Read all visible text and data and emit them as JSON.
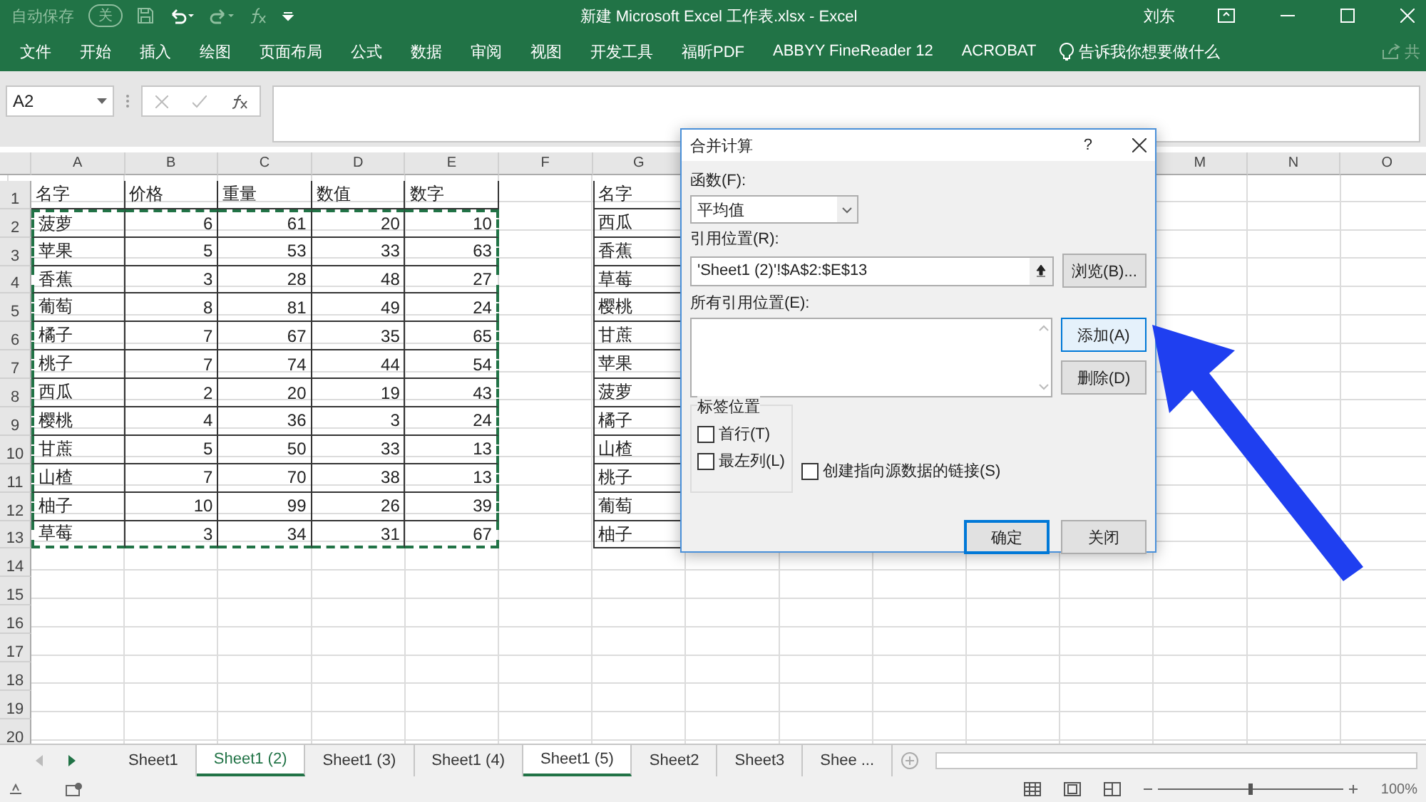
{
  "title_bar": {
    "autosave_label": "自动保存",
    "autosave_toggle": "关",
    "autosave_on": false,
    "title": "新建 Microsoft Excel 工作表.xlsx  -  Excel",
    "user": "刘东"
  },
  "ribbon_tabs": [
    {
      "label": "文件"
    },
    {
      "label": "开始"
    },
    {
      "label": "插入"
    },
    {
      "label": "绘图"
    },
    {
      "label": "页面布局"
    },
    {
      "label": "公式"
    },
    {
      "label": "数据"
    },
    {
      "label": "审阅"
    },
    {
      "label": "视图"
    },
    {
      "label": "开发工具"
    },
    {
      "label": "福昕PDF"
    },
    {
      "label": "ABBYY FineReader 12"
    },
    {
      "label": "ACROBAT"
    }
  ],
  "tell_me": "告诉我你想要做什么",
  "share_label": "共",
  "formula_bar": {
    "name_box": "A2"
  },
  "column_headers": [
    "A",
    "B",
    "C",
    "D",
    "E",
    "F",
    "G",
    "M",
    "N",
    "O"
  ],
  "row_numbers": [
    "1",
    "2",
    "3",
    "4",
    "5",
    "6",
    "7",
    "8",
    "9",
    "10",
    "11",
    "12",
    "13",
    "14",
    "15",
    "16",
    "17",
    "18",
    "19",
    "20"
  ],
  "table": {
    "marquee": true,
    "header": [
      "名字",
      "价格",
      "重量",
      "数值",
      "数字"
    ],
    "rows": [
      [
        "菠萝",
        "6",
        "61",
        "20",
        "10"
      ],
      [
        "苹果",
        "5",
        "53",
        "33",
        "63"
      ],
      [
        "香蕉",
        "3",
        "28",
        "48",
        "27"
      ],
      [
        "葡萄",
        "8",
        "81",
        "49",
        "24"
      ],
      [
        "橘子",
        "7",
        "67",
        "35",
        "65"
      ],
      [
        "桃子",
        "7",
        "74",
        "44",
        "54"
      ],
      [
        "西瓜",
        "2",
        "20",
        "19",
        "43"
      ],
      [
        "樱桃",
        "4",
        "36",
        "3",
        "24"
      ],
      [
        "甘蔗",
        "5",
        "50",
        "33",
        "13"
      ],
      [
        "山楂",
        "7",
        "70",
        "38",
        "13"
      ],
      [
        "柚子",
        "10",
        "99",
        "26",
        "39"
      ],
      [
        "草莓",
        "3",
        "34",
        "31",
        "67"
      ]
    ]
  },
  "list_g": [
    "名字",
    "西瓜",
    "香蕉",
    "草莓",
    "樱桃",
    "甘蔗",
    "苹果",
    "菠萝",
    "橘子",
    "山楂",
    "桃子",
    "葡萄",
    "柚子"
  ],
  "dialog": {
    "title": "合并计算",
    "help": "?",
    "function_label": "函数(F):",
    "function_value": "平均值",
    "reference_label": "引用位置(R):",
    "reference_value": "'Sheet1 (2)'!$A$2:$E$13",
    "browse_button": "浏览(B)...",
    "all_references_label": "所有引用位置(E):",
    "add_button": "添加(A)",
    "add_focused": true,
    "delete_button": "删除(D)",
    "group_label": "标签位置",
    "options": [
      {
        "label": "首行(T)",
        "checked": false
      },
      {
        "label": "最左列(L)",
        "checked": false
      },
      {
        "label": "创建指向源数据的链接(S)",
        "checked": false
      }
    ],
    "ok_button": "确定",
    "close_button": "关闭"
  },
  "sheet_tabs": [
    {
      "label": "Sheet1",
      "selected": false,
      "grouped": false
    },
    {
      "label": "Sheet1 (2)",
      "selected": true,
      "grouped": true
    },
    {
      "label": "Sheet1 (3)",
      "selected": false,
      "grouped": false
    },
    {
      "label": "Sheet1 (4)",
      "selected": false,
      "grouped": false
    },
    {
      "label": "Sheet1 (5)",
      "selected": false,
      "grouped": true
    },
    {
      "label": "Sheet2",
      "selected": false,
      "grouped": false
    },
    {
      "label": "Sheet3",
      "selected": false,
      "grouped": false
    },
    {
      "label": "Shee ...",
      "selected": false,
      "grouped": false
    }
  ],
  "status_bar": {
    "zoom": "100%",
    "zoom_slider": {
      "level": 0.5
    }
  }
}
